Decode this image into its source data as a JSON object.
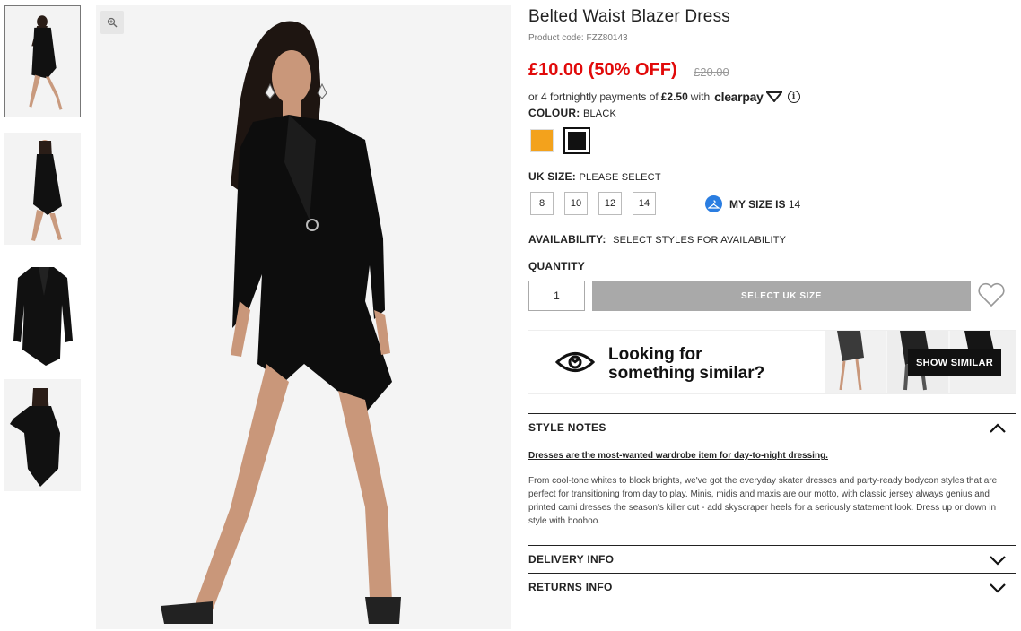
{
  "product": {
    "title": "Belted Waist Blazer Dress",
    "code": "Product code: FZZ80143",
    "price": "£10.00 (50% OFF)",
    "was_price": "£20.00",
    "clearpay_prefix": "or 4 fortnightly payments of",
    "clearpay_amount": "£2.50",
    "clearpay_with": "with",
    "clearpay_brand": "clearpay",
    "info_glyph": "i"
  },
  "colour": {
    "label": "COLOUR:",
    "value": "BLACK",
    "swatches": [
      "#f3a21c",
      "#111111"
    ]
  },
  "size": {
    "label": "UK SIZE:",
    "value": "PLEASE SELECT",
    "options": [
      "8",
      "10",
      "12",
      "14"
    ],
    "my_size_label": "MY SIZE IS",
    "my_size_value": "14"
  },
  "availability": {
    "label": "AVAILABILITY:",
    "value": "SELECT STYLES FOR AVAILABILITY"
  },
  "quantity": {
    "label": "QUANTITY",
    "value": "1"
  },
  "add_button": "SELECT UK SIZE",
  "similar": {
    "line1": "Looking for",
    "line2": "something similar?",
    "button": "SHOW SIMILAR"
  },
  "style_notes": {
    "heading": "STYLE NOTES",
    "lead": "Dresses are the most-wanted wardrobe item for day-to-night dressing.",
    "body": "From cool-tone whites to block brights, we've got the everyday skater dresses and party-ready bodycon styles that are perfect for transitioning from day to play. Minis, midis and maxis are our motto, with classic jersey always genius and printed cami dresses the season's killer cut - add skyscraper heels for a seriously statement look. Dress up or down in style with boohoo."
  },
  "delivery": {
    "heading": "DELIVERY INFO"
  },
  "returns": {
    "heading": "RETURNS INFO"
  },
  "icons": {
    "zoom": "zoom-icon",
    "hanger": "hanger-icon",
    "wishlist": "heart-icon",
    "eye": "eye-icon",
    "chevron_up": "chevron-up-icon",
    "chevron_down": "chevron-down-icon"
  },
  "colors": {
    "price_red": "#e10a0a",
    "button_grey": "#a9a9a9",
    "accent_blue": "#2a7de1"
  }
}
